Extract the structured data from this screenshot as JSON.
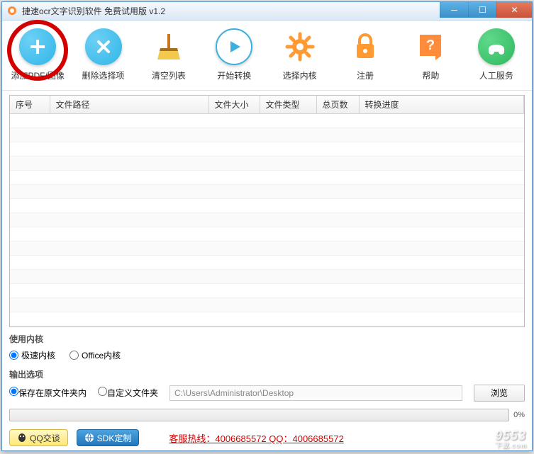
{
  "window": {
    "title": "捷速ocr文字识别软件 免费试用版 v1.2"
  },
  "toolbar": {
    "add": "添加PDF/图像",
    "delete": "删除选择项",
    "clear": "清空列表",
    "start": "开始转换",
    "core": "选择内核",
    "register": "注册",
    "help": "帮助",
    "service": "人工服务"
  },
  "table": {
    "cols": {
      "index": "序号",
      "path": "文件路径",
      "size": "文件大小",
      "type": "文件类型",
      "pages": "总页数",
      "progress": "转换进度"
    }
  },
  "kernel": {
    "title": "使用内核",
    "fast": "极速内核",
    "office": "Office内核"
  },
  "output": {
    "title": "输出选项",
    "keep": "保存在原文件夹内",
    "custom": "自定义文件夹",
    "path": "C:\\Users\\Administrator\\Desktop",
    "browse": "浏览"
  },
  "progress": {
    "pct": "0%"
  },
  "footer": {
    "qq": "QQ交谈",
    "sdk": "SDK定制",
    "hotline": "客服热线：4006685572 QQ：4006685572",
    "watermark": "9553",
    "watermark_sub": "下載.com"
  }
}
